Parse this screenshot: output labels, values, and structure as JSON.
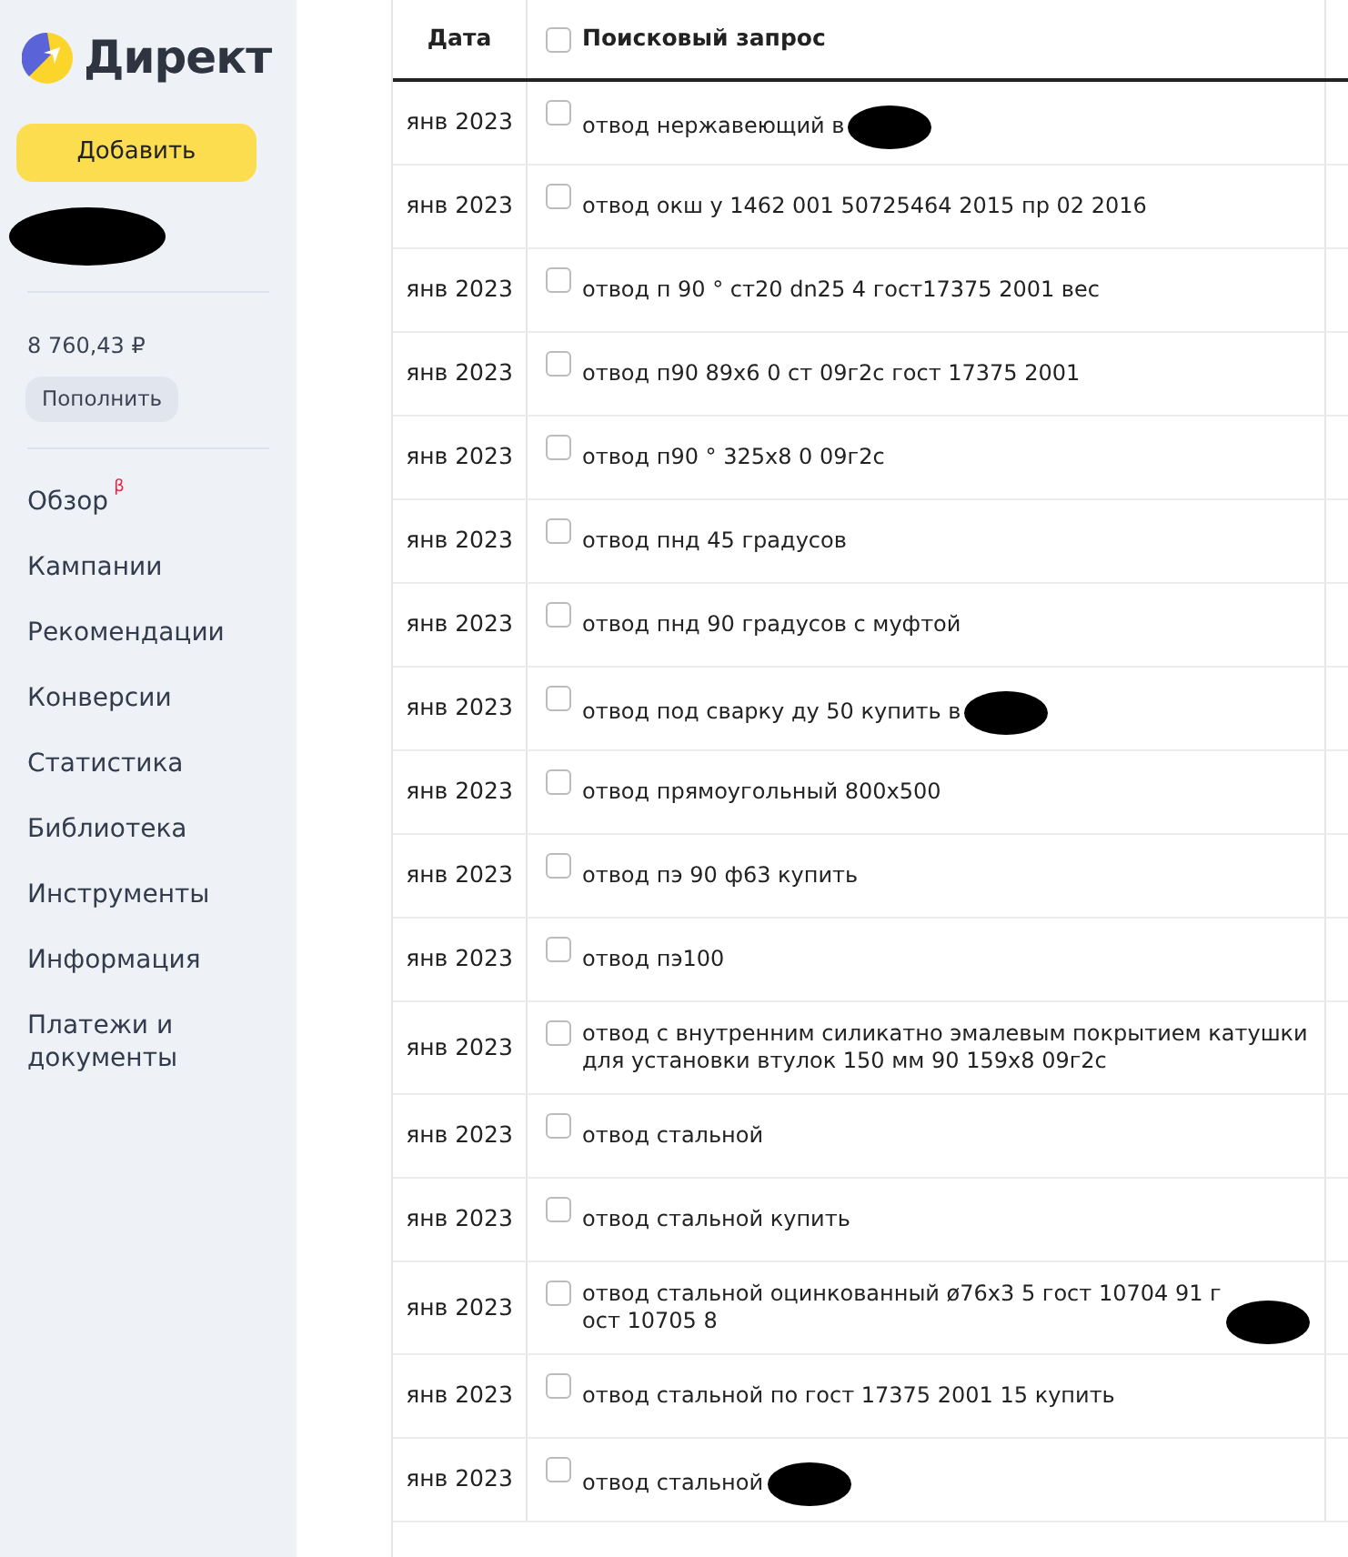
{
  "sidebar": {
    "logo": "Директ",
    "add_button": "Добавить",
    "account": {
      "redacted": true
    },
    "balance": "8 760,43 ₽",
    "top_up_button": "Пополнить",
    "items": [
      {
        "label": "Обзор",
        "badge": "β"
      },
      {
        "label": "Кампании"
      },
      {
        "label": "Рекомендации"
      },
      {
        "label": "Конверсии"
      },
      {
        "label": "Статистика"
      },
      {
        "label": "Библиотека"
      },
      {
        "label": "Инструменты"
      },
      {
        "label": "Информация"
      },
      {
        "label": "Платежи и документы"
      }
    ]
  },
  "table": {
    "columns": [
      "Дата",
      "Поисковый запрос"
    ],
    "header_checked": false,
    "rows": [
      {
        "date": "янв 2023",
        "query": "отвод нержавеющий в",
        "checked": false,
        "redacted": true
      },
      {
        "date": "янв 2023",
        "query": "отвод окш у 1462 001 50725464 2015 пр 02 2016",
        "checked": false,
        "redacted": false
      },
      {
        "date": "янв 2023",
        "query": "отвод п 90 ° ст20 dn25 4 гост17375 2001 вес",
        "checked": false,
        "redacted": false
      },
      {
        "date": "янв 2023",
        "query": "отвод п90 89х6 0 ст 09г2с гост 17375 2001",
        "checked": false,
        "redacted": false
      },
      {
        "date": "янв 2023",
        "query": "отвод п90 ° 325х8 0 09г2с",
        "checked": false,
        "redacted": false
      },
      {
        "date": "янв 2023",
        "query": "отвод пнд 45 градусов",
        "checked": false,
        "redacted": false
      },
      {
        "date": "янв 2023",
        "query": "отвод пнд 90 градусов с муфтой",
        "checked": false,
        "redacted": false
      },
      {
        "date": "янв 2023",
        "query": "отвод под сварку ду 50 купить в",
        "checked": false,
        "redacted": true
      },
      {
        "date": "янв 2023",
        "query": "отвод прямоугольный 800х500",
        "checked": false,
        "redacted": false
      },
      {
        "date": "янв 2023",
        "query": "отвод пэ 90 ф63 купить",
        "checked": false,
        "redacted": false
      },
      {
        "date": "янв 2023",
        "query": "отвод пэ100",
        "checked": false,
        "redacted": false
      },
      {
        "date": "янв 2023",
        "query": "отвод с внутренним силикатно эмалевым покрытием катушки для установки втулок 150 мм 90 159х8 09г2с",
        "checked": false,
        "redacted": false
      },
      {
        "date": "янв 2023",
        "query": "отвод стальной",
        "checked": false,
        "redacted": false
      },
      {
        "date": "янв 2023",
        "query": "отвод стальной купить",
        "checked": false,
        "redacted": false
      },
      {
        "date": "янв 2023",
        "query": "отвод стальной оцинкованный ø76х3 5 гост 10704 91 гост 10705 8",
        "checked": false,
        "redacted": true
      },
      {
        "date": "янв 2023",
        "query": "отвод стальной по гост 17375 2001 15 купить",
        "checked": false,
        "redacted": false
      },
      {
        "date": "янв 2023",
        "query": "отвод стальной",
        "checked": false,
        "redacted": true
      }
    ]
  }
}
